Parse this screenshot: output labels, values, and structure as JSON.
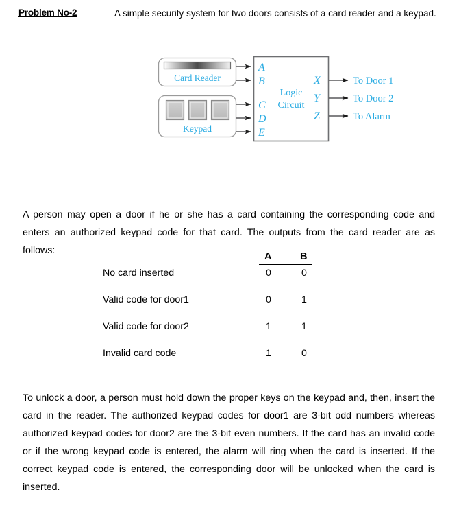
{
  "document": {
    "problem_label": "Problem No-2",
    "intro": "A simple security system for two doors consists of a card reader and a keypad.",
    "paragraph_1": "A person may open a door if he or she has a card containing the corresponding code and enters an authorized keypad code for that card. The outputs from the card reader are as follows:",
    "paragraph_2": "To unlock a door, a person must hold down the proper keys on the keypad and, then, insert the card in the reader. The authorized keypad codes for door1 are 3-bit odd numbers whereas authorized keypad codes for door2 are the 3-bit even numbers. If the card has an invalid code or if the wrong keypad code is entered, the alarm will ring when the card is inserted. If the correct keypad code is entered, the corresponding door will be unlocked when the card is inserted."
  },
  "figure": {
    "accent_color": "#29ABE2",
    "line_color": "#58595B",
    "card_reader_label": "Card Reader",
    "keypad_label": "Keypad",
    "logic_line_1": "Logic",
    "logic_line_2": "Circuit",
    "inputs": [
      {
        "name": "A"
      },
      {
        "name": "B"
      },
      {
        "name": "C"
      },
      {
        "name": "D"
      },
      {
        "name": "E"
      }
    ],
    "outputs": [
      {
        "name": "X",
        "destination": "To Door 1"
      },
      {
        "name": "Y",
        "destination": "To Door 2"
      },
      {
        "name": "Z",
        "destination": "To Alarm"
      }
    ]
  },
  "io_table": {
    "columns": [
      "A",
      "B"
    ],
    "rows": [
      {
        "label": "No card inserted",
        "a": "0",
        "b": "0"
      },
      {
        "label": "Valid code for door1",
        "a": "0",
        "b": "1"
      },
      {
        "label": "Valid code for door2",
        "a": "1",
        "b": "1"
      },
      {
        "label": "Invalid card code",
        "a": "1",
        "b": "0"
      }
    ]
  }
}
